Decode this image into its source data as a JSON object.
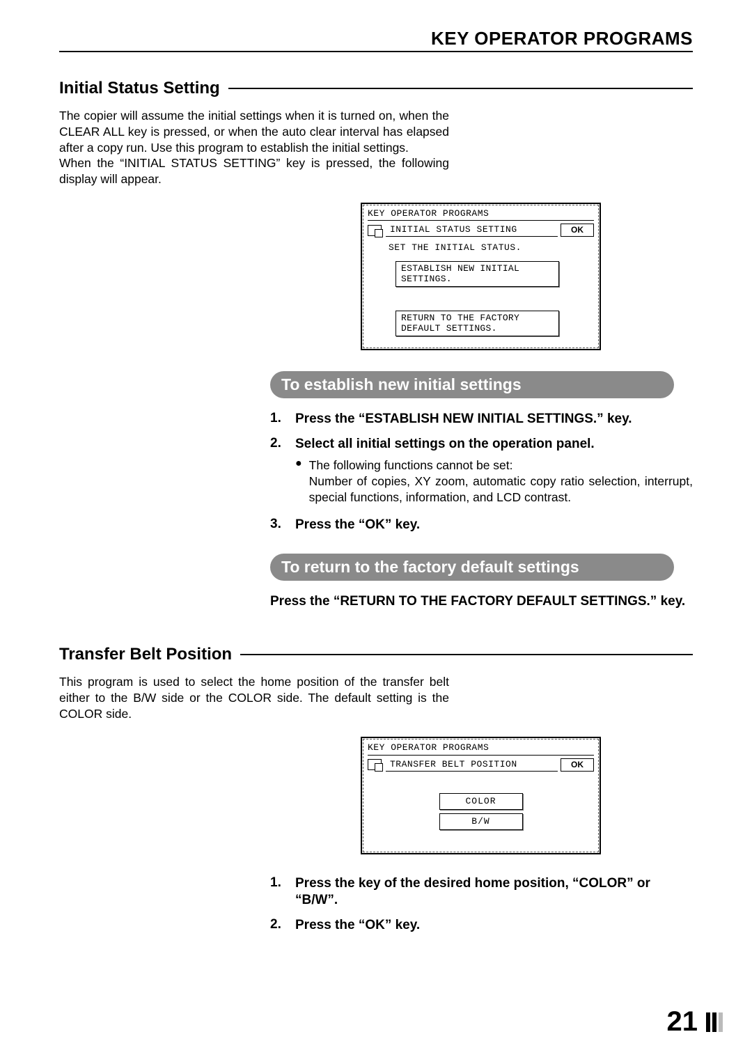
{
  "header": {
    "title": "KEY OPERATOR PROGRAMS"
  },
  "section1": {
    "heading": "Initial Status Setting",
    "intro": "The copier will assume the initial settings when it is turned on, when the CLEAR ALL key is pressed, or when the auto clear interval has elapsed after a copy run. Use this program to establish the initial settings.\nWhen the “INITIAL STATUS SETTING” key is pressed, the following display will appear.",
    "lcd": {
      "top": "KEY OPERATOR PROGRAMS",
      "screen_title": "INITIAL STATUS SETTING",
      "ok": "OK",
      "sub": "SET THE INITIAL STATUS.",
      "btn1": "ESTABLISH NEW INITIAL SETTINGS.",
      "btn2": "RETURN TO THE FACTORY DEFAULT SETTINGS."
    },
    "pill1": "To establish new initial settings",
    "steps1": {
      "s1": "Press the “ESTABLISH NEW INITIAL SETTINGS.” key.",
      "s2": "Select all initial settings on the operation panel.",
      "s2_bullet": "The following functions cannot be set:",
      "s2_detail": "Number of copies, XY zoom, automatic copy ratio selection, interrupt, special functions, information, and LCD contrast.",
      "s3": "Press the “OK” key."
    },
    "pill2": "To return to the factory default settings",
    "instr2": "Press the “RETURN TO THE FACTORY DEFAULT SETTINGS.” key."
  },
  "section2": {
    "heading": "Transfer Belt Position",
    "intro": "This program is used to select the home position of the transfer belt either to the B/W side or the COLOR side. The default setting is the COLOR side.",
    "lcd": {
      "top": "KEY OPERATOR PROGRAMS",
      "screen_title": "TRANSFER BELT POSITION",
      "ok": "OK",
      "opt1": "COLOR",
      "opt2": "B/W"
    },
    "steps": {
      "s1": "Press the key of the desired home position, “COLOR” or “B/W”.",
      "s2": "Press the “OK” key."
    }
  },
  "page_number": "21"
}
